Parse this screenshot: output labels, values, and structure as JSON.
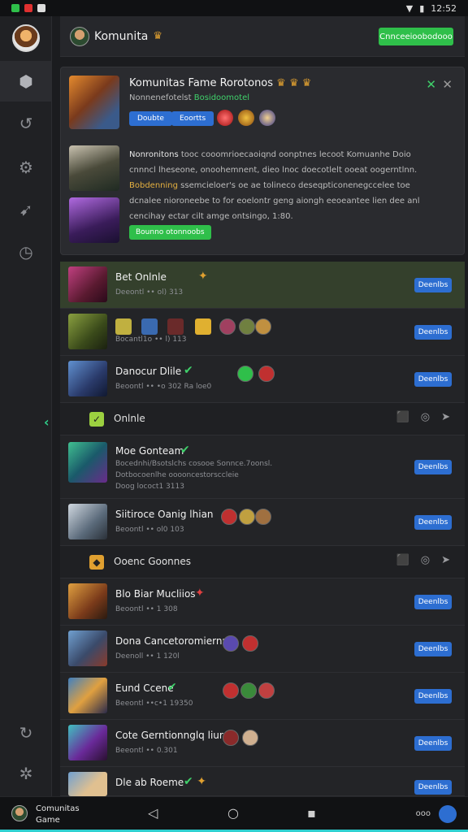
{
  "status": {
    "time": "12:52"
  },
  "topbar": {
    "title": "Komunita",
    "cta_label": "Cnnceeioobodooo"
  },
  "featured": {
    "title": "Komunitas Fame Rorotonos",
    "subtitle": "Nonnenefotelst",
    "subtitle_highlight": "Bosidoomotel",
    "chips": [
      "Doubte",
      "Eoortts"
    ],
    "body_heading": "Nonronitons",
    "body_line1": "tooc cooomrioecaoiqnd oonptnes lecoot Komuanhe Doio cnnncl lheseone, onoohemnent, dieo lnoc doecotlelt ooeat oogerntlnn.",
    "body_highlight": "Bobdenning",
    "body_line2": "ssemcieloer's oe ae tolineco deseqpticonenegccelee toe dcnalee nioroneebe to for eoelontr geng aiongh eeoeantee lien dee anl cencihay ectar cilt amge ontsingo, 1:80.",
    "body_accent": "1:80.",
    "green_button": "Bounno otonnoobs"
  },
  "rows": [
    {
      "name": "Bet Onlnle",
      "meta": "Deeontl •• ol) 313",
      "button": "Deenlbs",
      "highlight": true
    },
    {
      "name": "",
      "meta": "Bocantl1o •• l) 113",
      "button": "Deenlbs"
    },
    {
      "name": "Danocur Dlile",
      "meta": "Beoontl •• •o 302",
      "meta2": "Ra loe0",
      "button": "Deenlbs"
    },
    {
      "section": true,
      "label": "Onlnle"
    },
    {
      "name": "Moe Gonteam",
      "meta": "Bocednhi/Bsotslchs cosooe Sonnce.7oonsl.",
      "meta_b": "Dotbocoenlhe ooooncestorsccleie",
      "meta_c": "Doog lococt1 3113",
      "button": "Deenlbs"
    },
    {
      "name": "Siitiroce Oanig lhian",
      "meta": "Beoontl •• ol0 103",
      "button": "Deenlbs"
    },
    {
      "section": true,
      "label": "Ooenc Goonnes"
    },
    {
      "name": "Blo Biar Mucliios",
      "meta": "Beoontl •• 1 308",
      "button": "Deenlbs"
    },
    {
      "name": "Dona Cancetoromiernun",
      "meta": "Deenoll •• 1 120l",
      "button": "Deenlbs"
    },
    {
      "name": "Eund Ccene",
      "meta": "Beeontl ••c•1 19350",
      "button": "Deenlbs"
    },
    {
      "name": "Cote Gerntionnglq liuran",
      "meta": "Beeontl •• 0.301",
      "button": "Deenlbs"
    },
    {
      "name": "Dle ab Roeme",
      "meta": "",
      "button": "Deenlbs"
    }
  ],
  "nav": {
    "label_line1": "Comunitas",
    "label_line2": "Game",
    "right_text": "ooo"
  },
  "colors": {
    "accent_green": "#2fbf4a",
    "accent_blue": "#2d6ed1",
    "row_highlight": "#34402c"
  }
}
